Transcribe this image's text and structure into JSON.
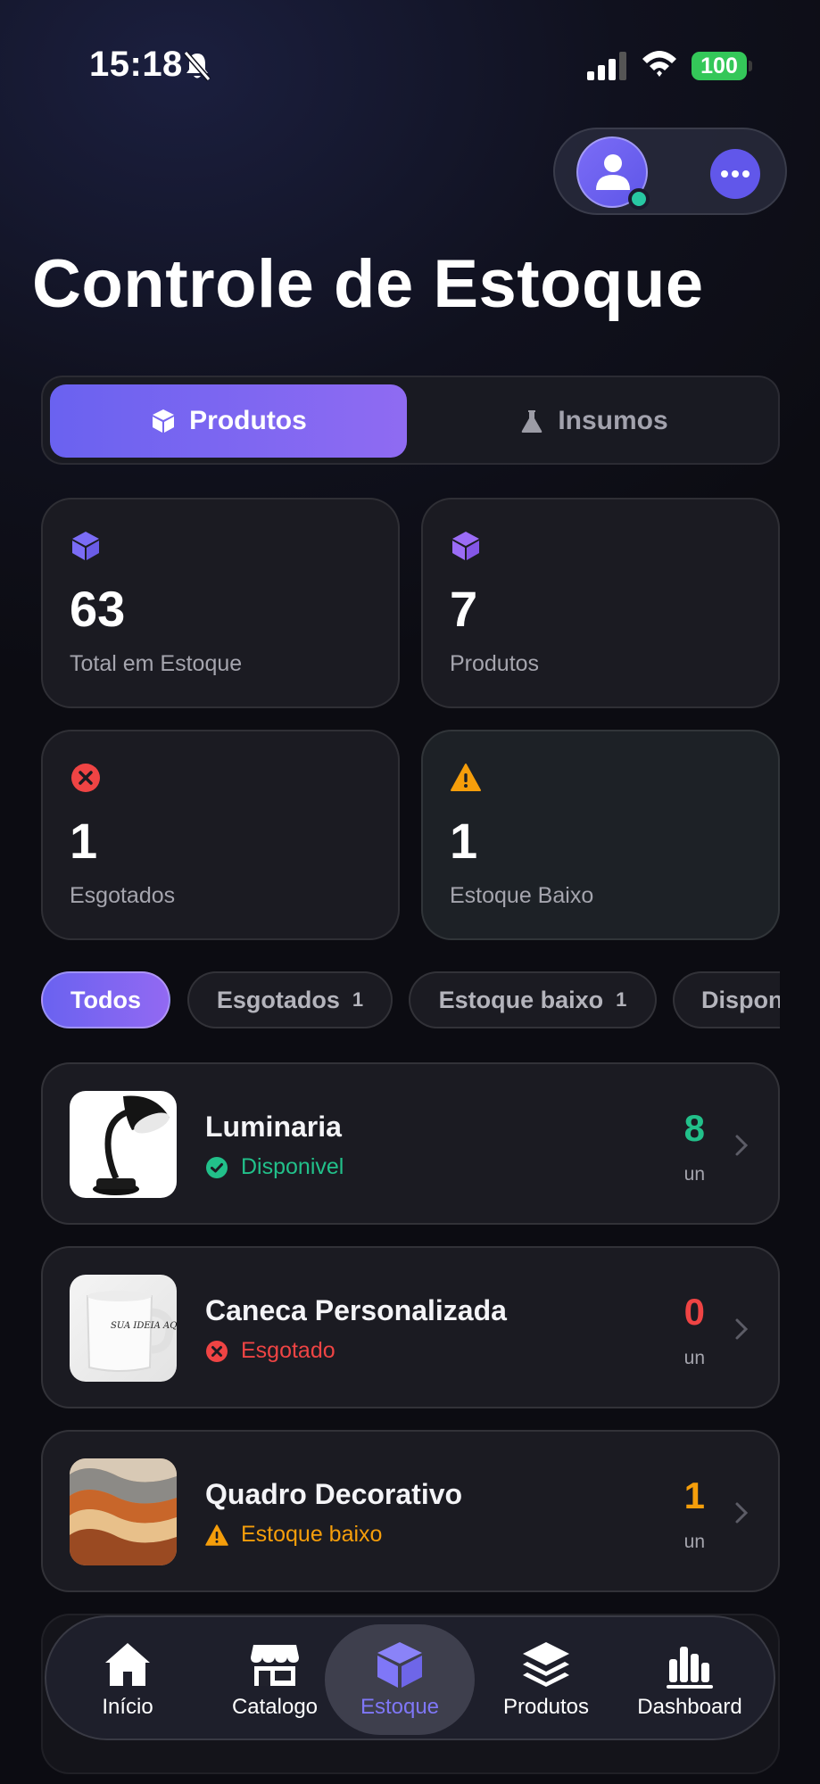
{
  "status_bar": {
    "time": "15:18",
    "battery": "100"
  },
  "header": {
    "title": "Controle de Estoque"
  },
  "segments": [
    {
      "label": "Produtos",
      "icon": "cube-icon",
      "active": true
    },
    {
      "label": "Insumos",
      "icon": "flask-icon",
      "active": false
    }
  ],
  "stats": [
    {
      "value": "63",
      "label": "Total em Estoque",
      "icon": "cube-icon",
      "color": "#7b6cf6"
    },
    {
      "value": "7",
      "label": "Produtos",
      "icon": "cube-icon",
      "color": "#8b5cf6"
    },
    {
      "value": "1",
      "label": "Esgotados",
      "icon": "x-circle-icon",
      "color": "#ef4444"
    },
    {
      "value": "1",
      "label": "Estoque Baixo",
      "icon": "warning-icon",
      "color": "#f59e0b"
    }
  ],
  "filters": [
    {
      "label": "Todos",
      "count": "",
      "active": true
    },
    {
      "label": "Esgotados",
      "count": "1",
      "active": false
    },
    {
      "label": "Estoque baixo",
      "count": "1",
      "active": false
    },
    {
      "label": "Disponivel",
      "count": "",
      "active": false
    }
  ],
  "products": [
    {
      "name": "Luminaria",
      "status": "Disponivel",
      "status_color": "#22c08a",
      "qty": "8",
      "qty_color": "#22c08a",
      "unit": "un"
    },
    {
      "name": "Caneca Personalizada",
      "status": "Esgotado",
      "status_color": "#ef4444",
      "qty": "0",
      "qty_color": "#ef4444",
      "unit": "un"
    },
    {
      "name": "Quadro Decorativo",
      "status": "Estoque baixo",
      "status_color": "#f59e0b",
      "qty": "1",
      "qty_color": "#f59e0b",
      "unit": "un"
    }
  ],
  "mug_text": "SUA IDEIA AQUI!",
  "tabs": [
    {
      "label": "Início",
      "icon": "home-icon",
      "active": false
    },
    {
      "label": "Catalogo",
      "icon": "store-icon",
      "active": false
    },
    {
      "label": "Estoque",
      "icon": "cube-icon",
      "active": true
    },
    {
      "label": "Produtos",
      "icon": "layers-icon",
      "active": false
    },
    {
      "label": "Dashboard",
      "icon": "bar-chart-icon",
      "active": false
    }
  ],
  "colors": {
    "accent": "#6a62f0",
    "success": "#22c08a",
    "danger": "#ef4444",
    "warning": "#f59e0b"
  }
}
